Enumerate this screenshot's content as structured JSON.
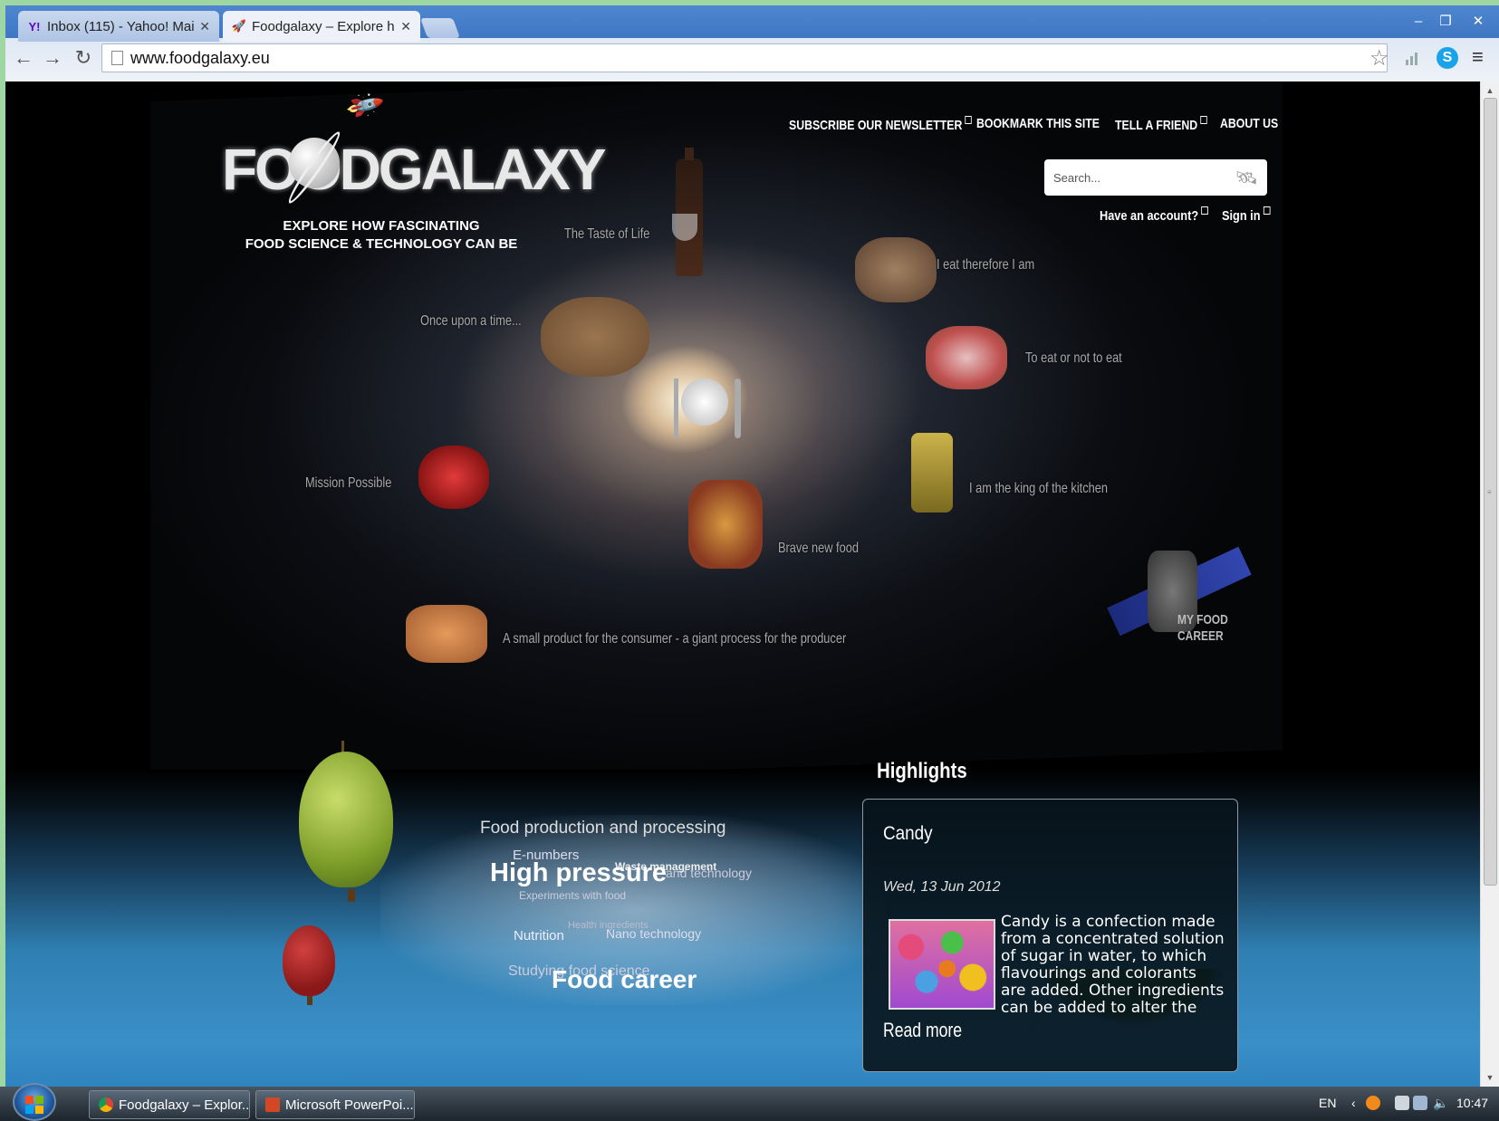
{
  "browser": {
    "tabs": [
      {
        "title": "Inbox (115) - Yahoo! Mail",
        "favicon": "yahoo-icon",
        "active": false
      },
      {
        "title": "Foodgalaxy – Explore how",
        "favicon": "rocket-icon",
        "active": true
      }
    ],
    "url": "www.foodgalaxy.eu",
    "close_glyph": "✕"
  },
  "site": {
    "logo_text": "FOODGALAXY",
    "tagline_line1": "EXPLORE HOW FASCINATING",
    "tagline_line2": "FOOD SCIENCE & TECHNOLOGY CAN BE",
    "nav": {
      "newsletter": "SUBSCRIBE OUR NEWSLETTER",
      "bookmark": "BOOKMARK THIS SITE",
      "tell_friend": "TELL A FRIEND",
      "about": "ABOUT US"
    },
    "search_placeholder": "Search...",
    "account": {
      "have_account": "Have an account?",
      "sign_in": "Sign in"
    },
    "galaxy_links": {
      "taste_of_life": "The Taste of Life",
      "eat_therefore": "I eat therefore I am",
      "once_upon": "Once upon a time...",
      "to_eat": "To eat or not to eat",
      "mission": "Mission Possible",
      "king_kitchen": "I am the king of the kitchen",
      "brave_new": "Brave new food",
      "small_product": "A small product for the consumer - a giant process for the producer"
    },
    "career": {
      "line1": "MY FOOD",
      "line2": "CAREER"
    },
    "tag_cloud": {
      "food_production": "Food production and processing",
      "enumbers": "E-numbers",
      "high_pressure": "High pressure",
      "waste": "Waste management",
      "and_technology": "and technology",
      "experiments": "Experiments with food",
      "health": "Health ingredients",
      "nutrition": "Nutrition",
      "nano": "Nano technology",
      "studying": "Studying food science",
      "food_career": "Food career"
    },
    "highlights": {
      "heading": "Highlights",
      "title": "Candy",
      "date": "Wed, 13 Jun 2012",
      "body": "Candy is a confection made from a concentrated solution of sugar in water, to which flavourings and colorants are added. Other ingredients can be added to alter the taste.",
      "read_more": "Read more"
    }
  },
  "taskbar": {
    "tasks": [
      {
        "label": "Foodgalaxy – Explor...",
        "icon": "chrome-icon"
      },
      {
        "label": "Microsoft PowerPoi...",
        "icon": "powerpoint-icon"
      }
    ],
    "language": "EN",
    "clock": "10:47"
  }
}
